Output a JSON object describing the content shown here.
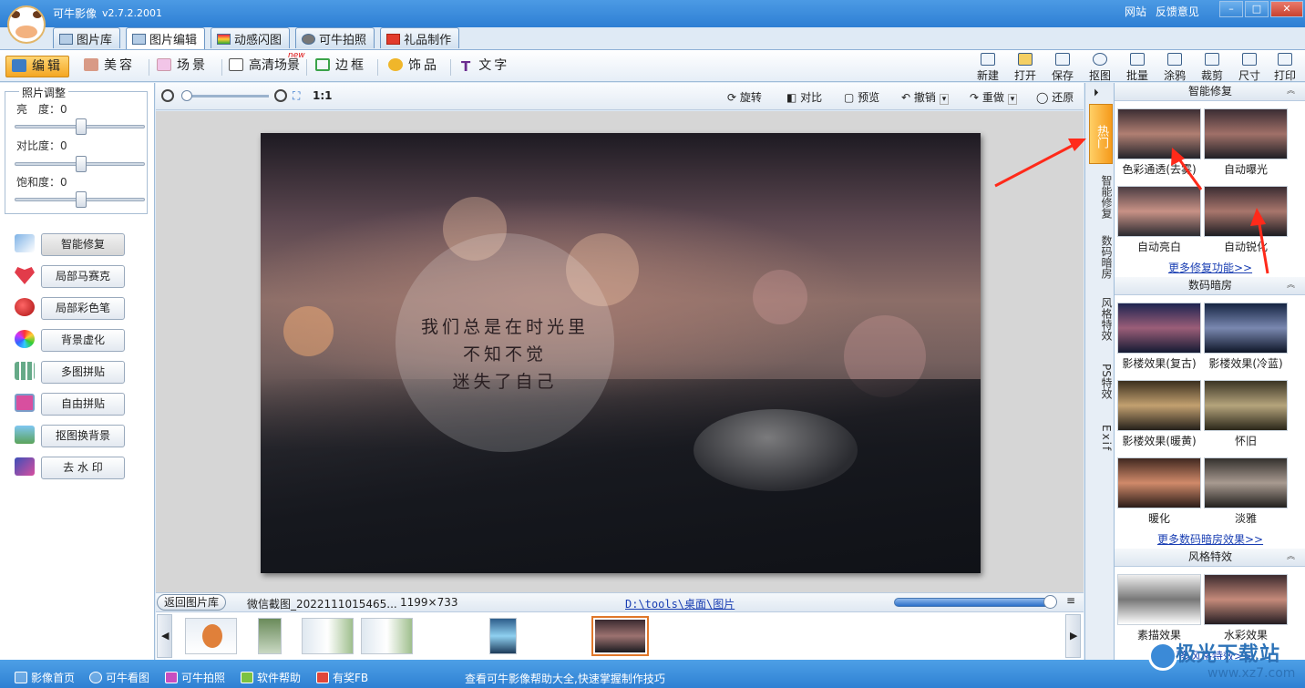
{
  "app": {
    "name": "可牛影像",
    "version": "v2.7.2.2001"
  },
  "top_links": [
    "网站",
    "反馈意见"
  ],
  "window_buttons": [
    "–",
    "□",
    "✕"
  ],
  "main_tabs": [
    "图片库",
    "图片编辑",
    "动感闪图",
    "可牛拍照",
    "礼品制作"
  ],
  "edit_tools": [
    "编辑",
    "美容",
    "场景",
    "高清场景",
    "边框",
    "饰品",
    "文字"
  ],
  "new_badge": "new",
  "file_tools": [
    "新建",
    "打开",
    "保存",
    "抠图",
    "批量",
    "涂鸦",
    "裁剪",
    "尺寸",
    "打印"
  ],
  "adjust": {
    "title": "照片调整",
    "brightness_label": "亮　度：0",
    "contrast_label": "对比度：0",
    "saturation_label": "饱和度：0",
    "brightness": 0,
    "contrast": 0,
    "saturation": 0
  },
  "left_buttons": [
    "智能修复",
    "局部马赛克",
    "局部彩色笔",
    "背景虚化",
    "多图拼贴",
    "自由拼贴",
    "抠图换背景",
    "去 水 印"
  ],
  "edit_bar": {
    "ratio": "1:1",
    "rotate": "旋转",
    "contrast": "对比",
    "preview": "预览",
    "undo": "撤销",
    "redo": "重做",
    "restore": "还原"
  },
  "photo_text": [
    "我们总是在时光里",
    "不知不觉",
    "迷失了自己"
  ],
  "status": {
    "back": "返回图片库",
    "filename": "微信截图_2022111015465...",
    "dimensions": "1199×733",
    "path": "D:\\tools\\桌面\\图片"
  },
  "side_tabs": [
    "热门",
    "智能修复",
    "数码暗房",
    "风格特效",
    "PS特效",
    "Exif"
  ],
  "right_panel": {
    "smart_repair": {
      "title": "智能修复",
      "items": [
        "色彩通透(去雾)",
        "自动曝光",
        "自动亮白",
        "自动锐化"
      ],
      "more": "更多修复功能>>"
    },
    "darkroom": {
      "title": "数码暗房",
      "items": [
        "影楼效果(复古)",
        "影楼效果(冷蓝)",
        "影楼效果(暖黄)",
        "怀旧",
        "暖化",
        "淡雅"
      ],
      "more": "更多数码暗房效果>>"
    },
    "style": {
      "title": "风格特效",
      "items": [
        "素描效果",
        "水彩效果"
      ],
      "more": "更多风格特效>>"
    }
  },
  "bottom_bar": {
    "items": [
      "影像首页",
      "可牛看图",
      "可牛拍照",
      "软件帮助",
      "有奖FB"
    ],
    "tip": "查看可牛影像帮助大全,快速掌握制作技巧"
  },
  "watermark": {
    "text": "极光下载站",
    "url": "www.xz7.com"
  },
  "colors": {
    "accent_blue": "#2f80d3",
    "active_orange": "#f4a723",
    "arrow_red": "#ff2a1a"
  }
}
